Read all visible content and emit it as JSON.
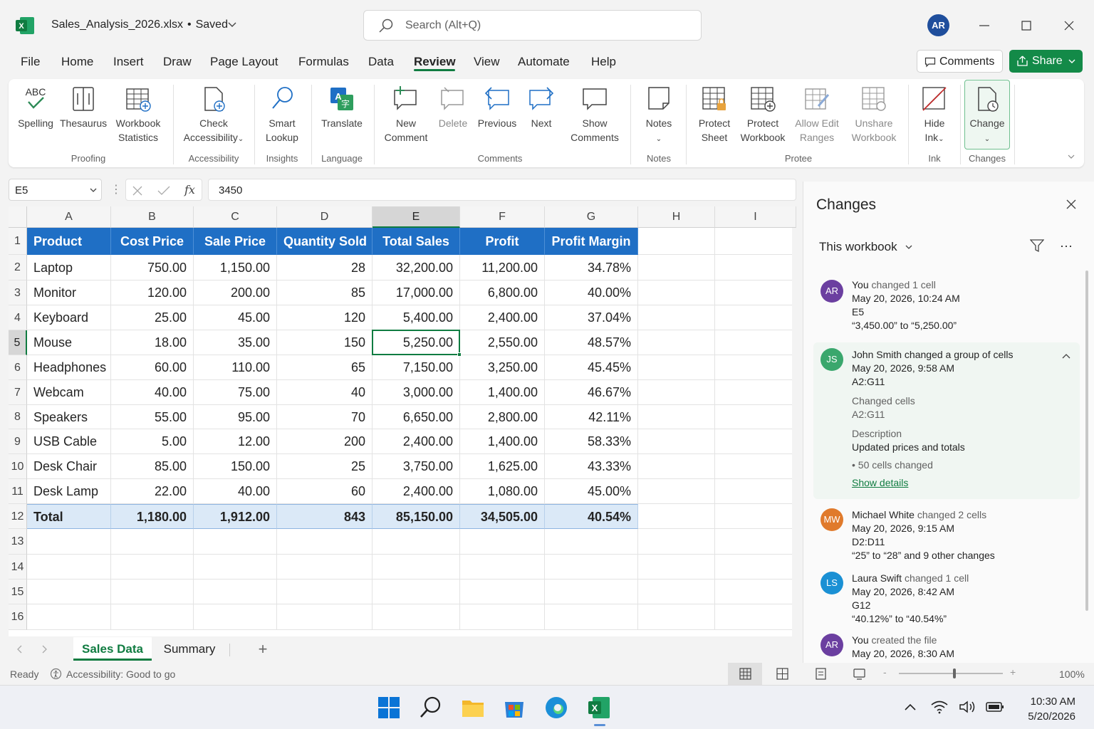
{
  "window": {
    "doc_title": "Sales_Analysis_2026.xlsx",
    "separator": "•",
    "save_status": "Saved",
    "search_placeholder": "Search (Alt+Q)",
    "user_initials": "AR"
  },
  "menu": {
    "items": [
      "File",
      "Home",
      "Insert",
      "Draw",
      "Page Layout",
      "Formulas",
      "Data",
      "Review",
      "View",
      "Automate",
      "Help"
    ],
    "active": "Review",
    "comments_label": "Comments",
    "share_label": "Share"
  },
  "ribbon": {
    "buttons": {
      "spelling_abc": "ABC",
      "spelling": "Spelling",
      "thesaurus": "Thesaurus",
      "workbook_statistics": [
        "Workbook",
        "Statistics"
      ],
      "check_accessibility": [
        "Check",
        "Accessibility"
      ],
      "smart_lookup": [
        "Smart",
        "Lookup"
      ],
      "translate": "Translate",
      "new_comment": [
        "New",
        "Comment"
      ],
      "delete": "Delete",
      "previous": "Previous",
      "next": "Next",
      "show_comments": [
        "Show",
        "Comments"
      ],
      "notes": "Notes",
      "protect_sheet": [
        "Protect",
        "Sheet"
      ],
      "protect_workbook": [
        "Protect",
        "Workbook"
      ],
      "allow_edit_ranges": [
        "Allow Edit",
        "Ranges"
      ],
      "unshare_workbook": [
        "Unshare",
        "Workbook"
      ],
      "hide_ink": [
        "Hide",
        "Ink"
      ],
      "changes": "Change"
    },
    "groups": {
      "proofing": "Proofing",
      "accessibility": "Accessibility",
      "insights": "Insights",
      "language": "Language",
      "comments": "Comments",
      "notes": "Notes",
      "protect": "Protee",
      "ink": "Ink",
      "changes": "Changes"
    }
  },
  "formula_bar": {
    "name_box": "E5",
    "fx": "fx",
    "value": "3450"
  },
  "sheet": {
    "columns": [
      "A",
      "B",
      "C",
      "D",
      "E",
      "F",
      "G",
      "H",
      "I"
    ],
    "selected_column": "E",
    "selected_row": 5,
    "row_numbers": [
      "1",
      "2",
      "3",
      "4",
      "5",
      "6",
      "7",
      "8",
      "9",
      "10",
      "11",
      "12",
      "13",
      "14",
      "15",
      "16"
    ],
    "header": [
      "Product",
      "Cost Price",
      "Sale Price",
      "Quantity Sold",
      "Total Sales",
      "Profit",
      "Profit Margin"
    ],
    "rows": [
      [
        "Laptop",
        "750.00",
        "1,150.00",
        "28",
        "32,200.00",
        "11,200.00",
        "34.78%"
      ],
      [
        "Monitor",
        "120.00",
        "200.00",
        "85",
        "17,000.00",
        "6,800.00",
        "40.00%"
      ],
      [
        "Keyboard",
        "25.00",
        "45.00",
        "120",
        "5,400.00",
        "2,400.00",
        "37.04%"
      ],
      [
        "Mouse",
        "18.00",
        "35.00",
        "150",
        "5,250.00",
        "2,550.00",
        "48.57%"
      ],
      [
        "Headphones",
        "60.00",
        "110.00",
        "65",
        "7,150.00",
        "3,250.00",
        "45.45%"
      ],
      [
        "Webcam",
        "40.00",
        "75.00",
        "40",
        "3,000.00",
        "1,400.00",
        "46.67%"
      ],
      [
        "Speakers",
        "55.00",
        "95.00",
        "70",
        "6,650.00",
        "2,800.00",
        "42.11%"
      ],
      [
        "USB Cable",
        "5.00",
        "12.00",
        "200",
        "2,400.00",
        "1,400.00",
        "58.33%"
      ],
      [
        "Desk Chair",
        "85.00",
        "150.00",
        "25",
        "3,750.00",
        "1,625.00",
        "43.33%"
      ],
      [
        "Desk Lamp",
        "22.00",
        "40.00",
        "60",
        "2,400.00",
        "1,080.00",
        "45.00%"
      ]
    ],
    "total": [
      "Total",
      "1,180.00",
      "1,912.00",
      "843",
      "85,150.00",
      "34,505.00",
      "40.54%"
    ],
    "tabs": [
      "Sales Data",
      "Summary"
    ],
    "active_tab": "Sales Data",
    "add_tab": "+"
  },
  "status": {
    "ready": "Ready",
    "accessibility": "Accessibility: Good to go",
    "zoom": "100%"
  },
  "changes_pane": {
    "title": "Changes",
    "scope": "This workbook",
    "more": "···",
    "entries": [
      {
        "initials": "AR",
        "color": "#6b3fa0",
        "name": "You",
        "action": "changed 1 cell",
        "time": "May 20, 2026, 10:24 AM",
        "range": "E5",
        "detail": "“3,450.00” to “5,250.00”"
      },
      {
        "initials": "JS",
        "color": "#3aa76d",
        "name": "John Smith changed a group of cells",
        "action": "",
        "time": "May 20, 2026, 9:58 AM",
        "range": "A2:G11",
        "changed_cells_label": "Changed cells",
        "changed_cells": "A2:G11",
        "description_label": "Description",
        "description": "Updated prices and totals",
        "count": "• 50 cells changed",
        "link": "Show details"
      },
      {
        "initials": "MW",
        "color": "#e07a2c",
        "name": "Michael White",
        "action": "changed 2 cells",
        "time": "May 20, 2026, 9:15 AM",
        "range": "D2:D11",
        "detail": "“25” to “28” and 9 other changes"
      },
      {
        "initials": "LS",
        "color": "#1a90d4",
        "name": "Laura Swift",
        "action": "changed 1 cell",
        "time": "May 20, 2026, 8:42 AM",
        "range": "G12",
        "detail": "“40.12%” to “40.54%”"
      },
      {
        "initials": "AR",
        "color": "#6b3fa0",
        "name": "You",
        "action": "created the file",
        "time": "May 20, 2026, 8:30 AM"
      }
    ]
  },
  "taskbar": {
    "time": "10:30 AM",
    "date": "5/20/2026"
  },
  "colors": {
    "accent": "#107c41",
    "table_header": "#1f6fc5",
    "total_row": "#dbe9f7"
  }
}
